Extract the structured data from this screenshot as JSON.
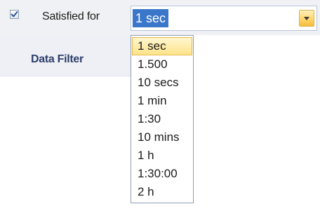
{
  "filter_row": {
    "checked": true,
    "label": "Satisfied for"
  },
  "tab": {
    "title": "Data Filter"
  },
  "combo": {
    "value": "1 sec",
    "options": [
      "1 sec",
      "1.500",
      "10 secs",
      "1 min",
      "1:30",
      "10 mins",
      "1 h",
      "1:30:00",
      "2 h"
    ],
    "selected_index": 0
  },
  "colors": {
    "selection_highlight": "#3a76c9",
    "hover_item": "#ffe48b",
    "tab_title": "#2f3f6b"
  },
  "icons": {
    "checkbox": "check-icon",
    "dropdown": "chevron-down-icon"
  }
}
